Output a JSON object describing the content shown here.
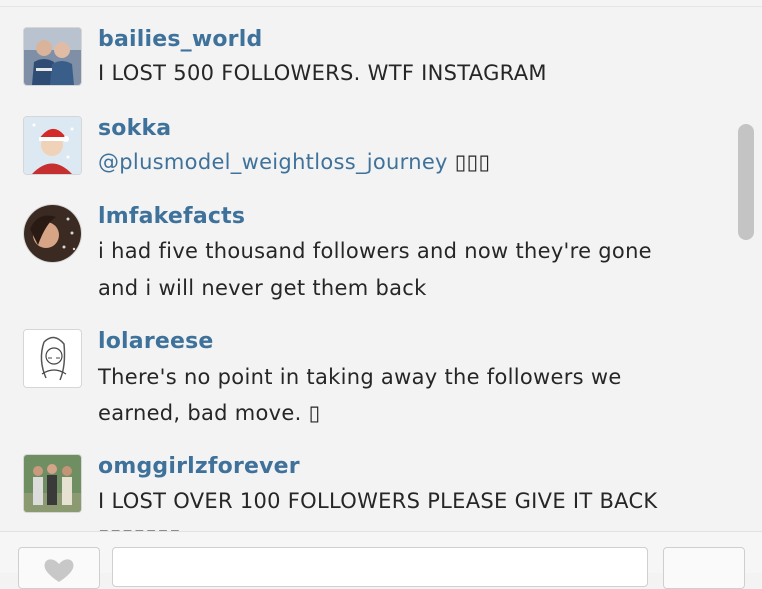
{
  "comments": [
    {
      "username": "bailies_world",
      "text": "I LOST 500 FOLLOWERS. WTF INSTAGRAM"
    },
    {
      "username": "sokka",
      "mention": "@plusmodel_weightloss_journey",
      "emoji": "▯▯▯"
    },
    {
      "username": "lmfakefacts",
      "line1": "i had five thousand followers and now they're gone",
      "line2": "and i will never get them back"
    },
    {
      "username": "lolareese",
      "line1": "There's no point in taking away the followers we",
      "line2": "earned, bad move. ▯"
    },
    {
      "username": "omggirlzforever",
      "line1": "I LOST OVER 100 FOLLOWERS PLEASE GIVE IT BACK",
      "line2": "▯▯▯▯▯▯▯"
    }
  ],
  "input": {
    "placeholder": ""
  },
  "colors": {
    "username": "#3f729b",
    "text": "#262626",
    "background": "#f3f3f3"
  },
  "icons": {
    "like": "heart-icon"
  }
}
